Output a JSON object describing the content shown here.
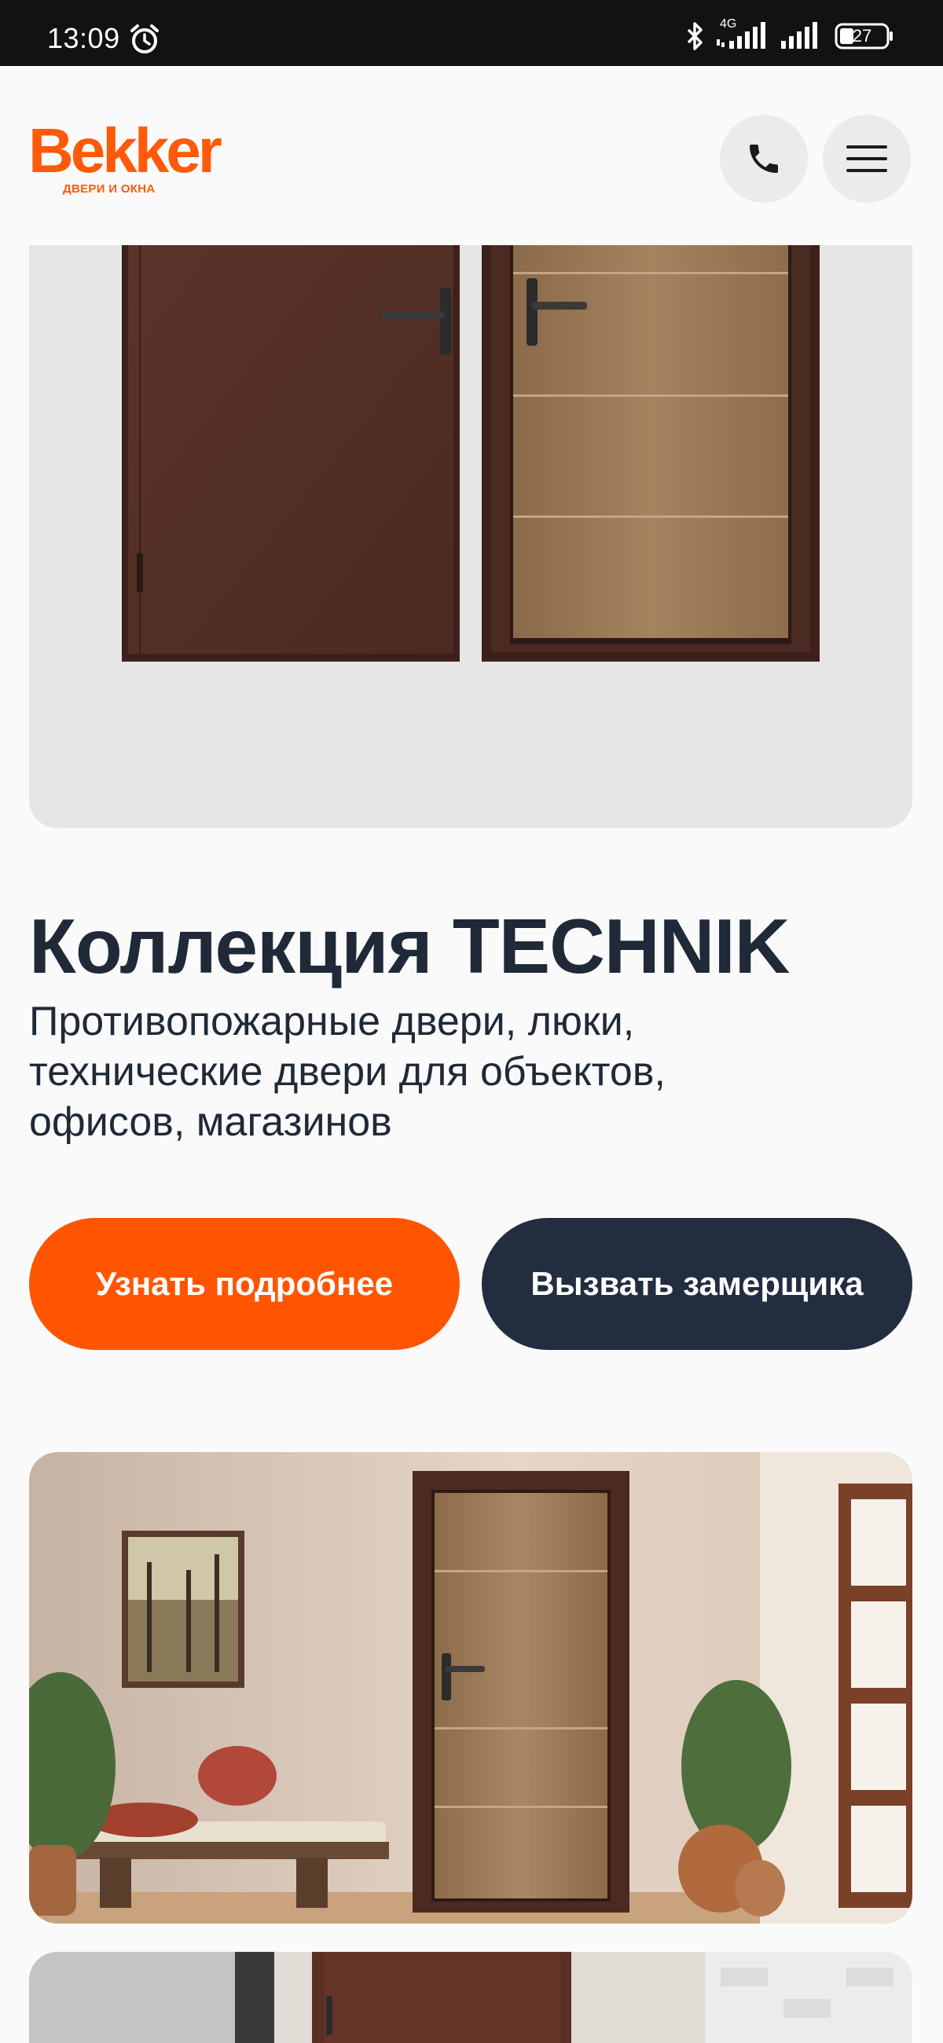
{
  "status_bar": {
    "time": "13:09",
    "network": "4G",
    "battery": "27",
    "icons": [
      "alarm-icon",
      "bluetooth-icon",
      "signal-icon",
      "battery-icon"
    ]
  },
  "header": {
    "logo_text": "Bekker",
    "logo_subtitle": "ДВЕРИ И ОКНА",
    "icons": [
      "phone-icon",
      "menu-icon"
    ]
  },
  "collection": {
    "title": "Коллекция TECHNIK",
    "description": "Противопожарные двери, люки, технические двери для объектов, офисов, магазинов"
  },
  "buttons": {
    "details": "Узнать подробнее",
    "measure": "Вызвать замерщика"
  },
  "colors": {
    "brand": "#ff5a0a",
    "primary_button": "#ff5500",
    "secondary_button": "#222d40",
    "text": "#1f2937"
  }
}
